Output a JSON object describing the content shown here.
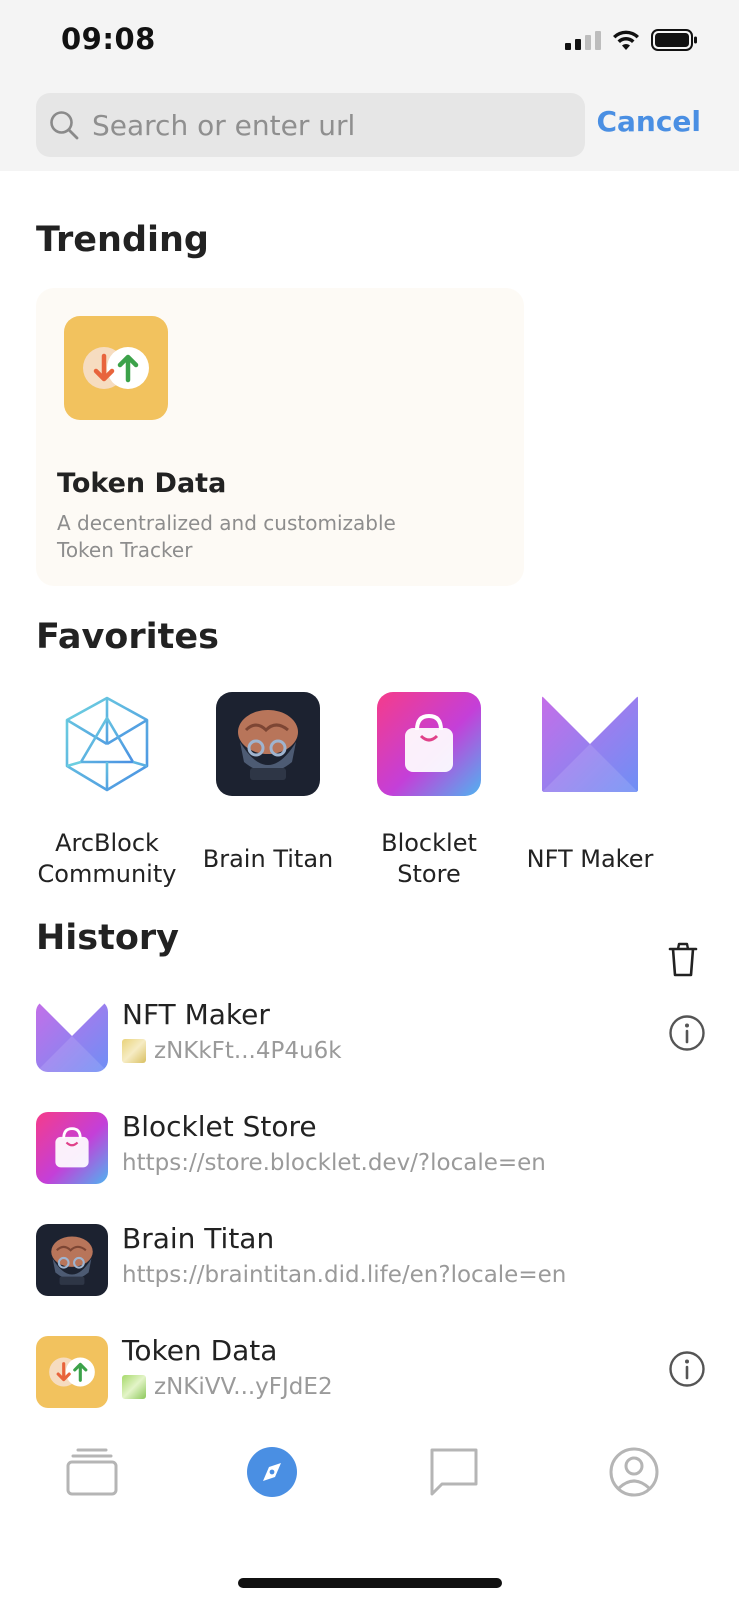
{
  "status_bar": {
    "time": "09:08"
  },
  "search": {
    "placeholder": "Search or enter url",
    "cancel_label": "Cancel"
  },
  "trending": {
    "title": "Trending",
    "card": {
      "name": "Token Data",
      "description": "A decentralized and customizable Token Tracker",
      "icon": "token-data-icon"
    }
  },
  "favorites": {
    "title": "Favorites",
    "items": [
      {
        "label": "ArcBlock Community",
        "icon": "arcblock-icon"
      },
      {
        "label": "Brain Titan",
        "icon": "brain-titan-icon"
      },
      {
        "label": "Blocklet Store",
        "icon": "blocklet-store-icon"
      },
      {
        "label": "NFT Maker",
        "icon": "nft-maker-icon"
      }
    ]
  },
  "history": {
    "title": "History",
    "items": [
      {
        "title": "NFT Maker",
        "subtitle": "zNKkFt...4P4u6k",
        "icon": "nft-maker-icon",
        "has_info": true
      },
      {
        "title": "Blocklet Store",
        "subtitle": "https://store.blocklet.dev/?locale=en",
        "icon": "blocklet-store-icon",
        "has_info": false
      },
      {
        "title": "Brain Titan",
        "subtitle": "https://braintitan.did.life/en?locale=en",
        "icon": "brain-titan-icon",
        "has_info": false
      },
      {
        "title": "Token Data",
        "subtitle": "zNKiVV...yFJdE2",
        "icon": "token-data-icon",
        "has_info": true
      }
    ]
  },
  "tabbar": {
    "tabs": [
      {
        "icon": "cards-icon",
        "active": false
      },
      {
        "icon": "compass-icon",
        "active": true
      },
      {
        "icon": "chat-icon",
        "active": false
      },
      {
        "icon": "profile-icon",
        "active": false
      }
    ]
  },
  "colors": {
    "accent": "#4a8fe3",
    "token_yellow": "#f2c25e",
    "nft_purple": "#9b6ee8"
  }
}
